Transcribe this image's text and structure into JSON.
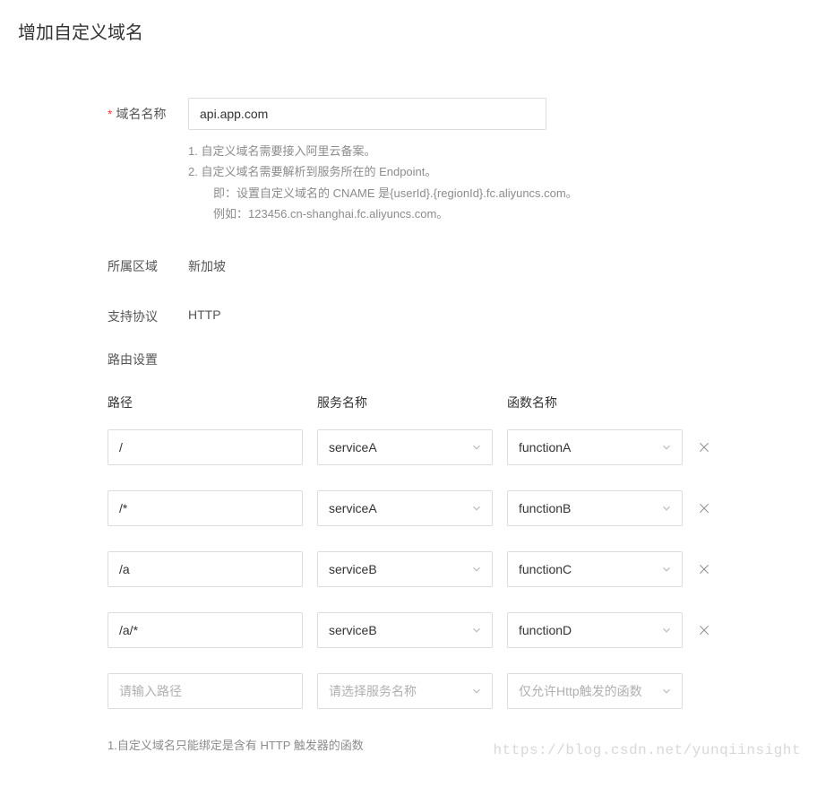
{
  "page": {
    "title": "增加自定义域名"
  },
  "domain": {
    "label": "域名名称",
    "value": "api.app.com",
    "hints": {
      "line1": "1. 自定义域名需要接入阿里云备案。",
      "line2": "2. 自定义域名需要解析到服务所在的 Endpoint。",
      "line3": "即：设置自定义域名的 CNAME 是{userId}.{regionId}.fc.aliyuncs.com。",
      "line4": "例如：123456.cn-shanghai.fc.aliyuncs.com。"
    }
  },
  "region": {
    "label": "所属区域",
    "value": "新加坡"
  },
  "protocol": {
    "label": "支持协议",
    "value": "HTTP"
  },
  "routes": {
    "section_label": "路由设置",
    "headers": {
      "path": "路径",
      "service": "服务名称",
      "function": "函数名称"
    },
    "rows": [
      {
        "path": "/",
        "service": "serviceA",
        "function": "functionA"
      },
      {
        "path": "/*",
        "service": "serviceA",
        "function": "functionB"
      },
      {
        "path": "/a",
        "service": "serviceB",
        "function": "functionC"
      },
      {
        "path": "/a/*",
        "service": "serviceB",
        "function": "functionD"
      }
    ],
    "placeholder_row": {
      "path_placeholder": "请输入路径",
      "service_placeholder": "请选择服务名称",
      "function_placeholder": "仅允许Http触发的函数"
    }
  },
  "footer": {
    "note": "1.自定义域名只能绑定是含有 HTTP 触发器的函数"
  },
  "watermark": "https://blog.csdn.net/yunqiinsight"
}
